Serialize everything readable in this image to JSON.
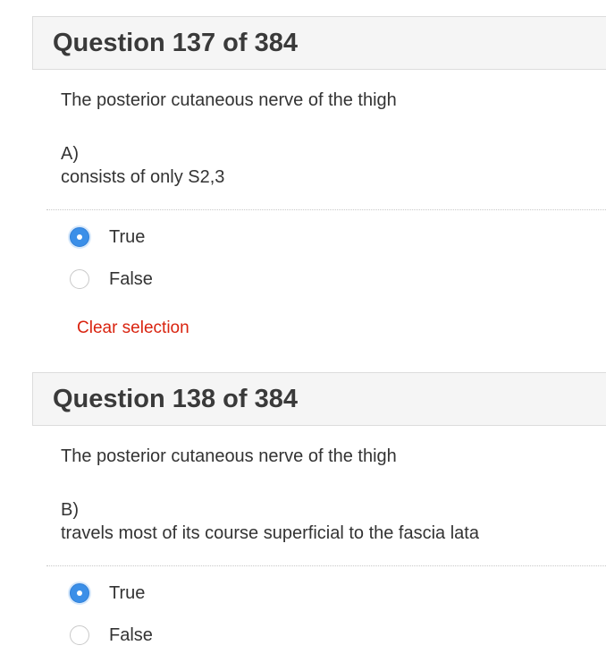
{
  "questions": [
    {
      "title": "Question 137 of 384",
      "stem": "The posterior cutaneous nerve of the thigh",
      "option_letter": "A)",
      "option_text": "consists of only S2,3",
      "choices": [
        {
          "label": "True",
          "selected": true
        },
        {
          "label": "False",
          "selected": false
        }
      ],
      "clear_label": "Clear selection"
    },
    {
      "title": "Question 138 of 384",
      "stem": "The posterior cutaneous nerve of the thigh",
      "option_letter": "B)",
      "option_text": "travels most of its course superficial to the fascia lata",
      "choices": [
        {
          "label": "True",
          "selected": true
        },
        {
          "label": "False",
          "selected": false
        }
      ]
    }
  ],
  "colors": {
    "accent_blue": "#3b8fe8",
    "clear_link_red": "#d9230f",
    "header_bg": "#f5f5f5"
  }
}
